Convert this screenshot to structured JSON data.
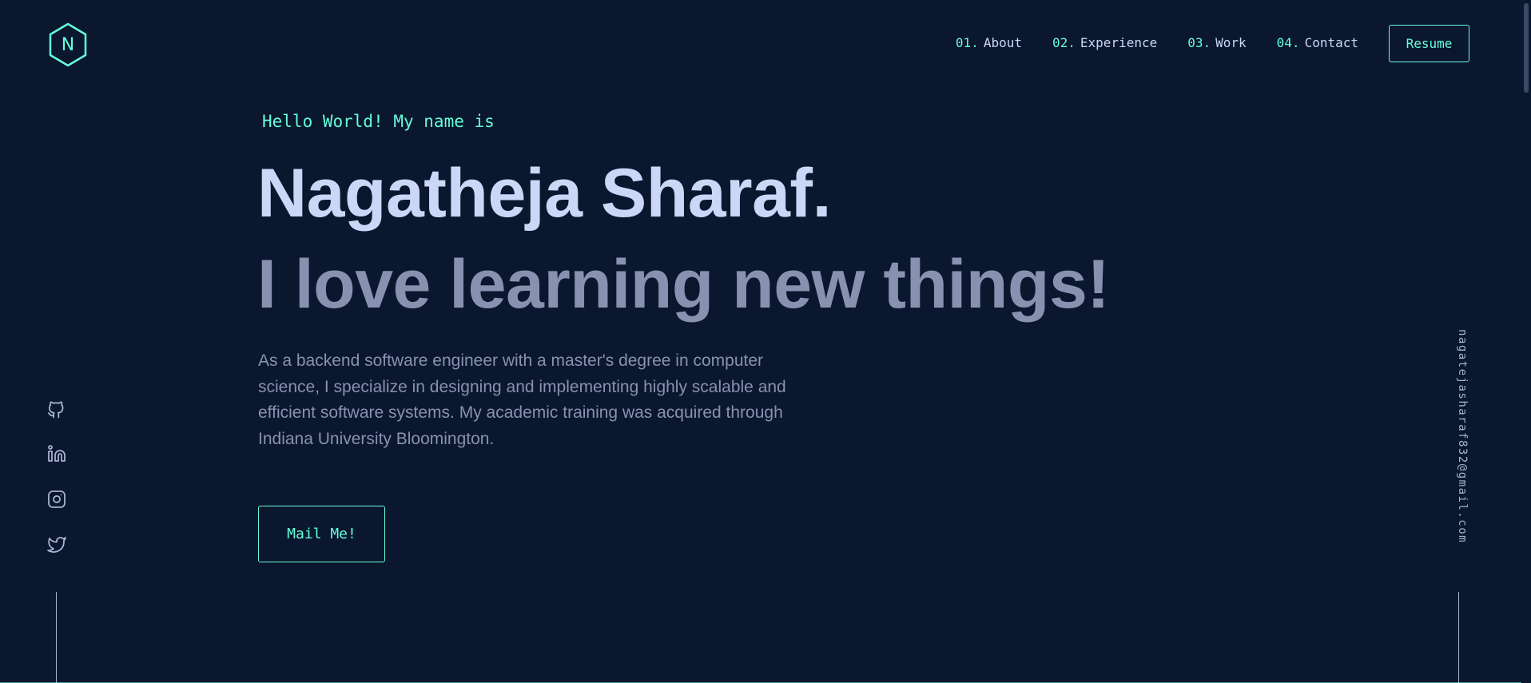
{
  "logo": {
    "letter": "N",
    "icon": "hexagon-logo-icon"
  },
  "nav": {
    "items": [
      {
        "num": "01.",
        "label": "About"
      },
      {
        "num": "02.",
        "label": "Experience"
      },
      {
        "num": "03.",
        "label": "Work"
      },
      {
        "num": "04.",
        "label": "Contact"
      }
    ],
    "resume_label": "Resume"
  },
  "hero": {
    "greeting": "Hello World! My name is",
    "name": "Nagatheja Sharaf.",
    "tagline": "I love learning new things!",
    "bio": "As a backend software engineer with a master's degree in computer science, I specialize in designing and implementing highly scalable and efficient software systems. My academic training was acquired through Indiana University Bloomington.",
    "mail_button": "Mail Me!"
  },
  "socials": [
    {
      "icon": "github-icon"
    },
    {
      "icon": "linkedin-icon"
    },
    {
      "icon": "instagram-icon"
    },
    {
      "icon": "twitter-icon"
    }
  ],
  "email": "nagatejasharaf832@gmail.com",
  "colors": {
    "background": "#0b172e",
    "accent": "#64ffda",
    "heading": "#ccd6f6",
    "muted": "#8892b0"
  }
}
